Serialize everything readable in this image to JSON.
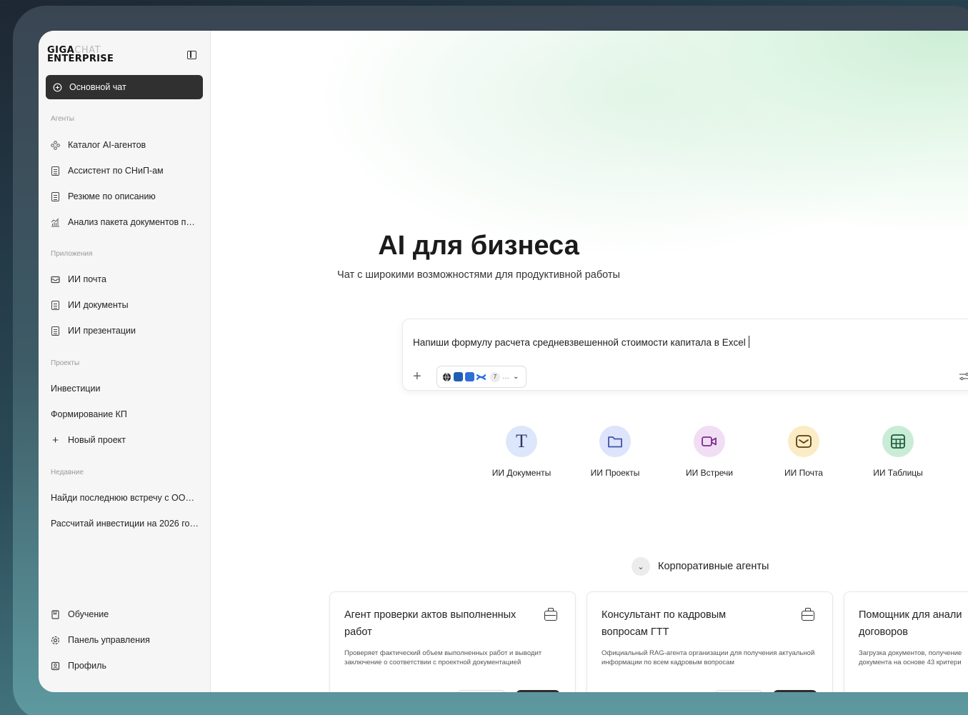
{
  "logo": {
    "part1": "GIGA",
    "part2": "CHAT",
    "part3": "ENTERPRISE"
  },
  "sidebar": {
    "main_chat": "Основной чат",
    "agents_label": "Агенты",
    "agents": [
      {
        "label": "Каталог AI-агентов",
        "icon": "agents-catalog-icon"
      },
      {
        "label": "Ассистент по СНиП-ам",
        "icon": "document-icon"
      },
      {
        "label": "Резюме по описанию",
        "icon": "document-icon"
      },
      {
        "label": "Анализ пакета документов п…",
        "icon": "chart-icon"
      }
    ],
    "apps_label": "Приложения",
    "apps": [
      {
        "label": "ИИ почта",
        "icon": "mail-icon"
      },
      {
        "label": "ИИ документы",
        "icon": "document-icon"
      },
      {
        "label": "ИИ презентации",
        "icon": "document-icon"
      }
    ],
    "projects_label": "Проекты",
    "projects": [
      "Инвестиции",
      "Формирование КП"
    ],
    "new_project": "Новый проект",
    "recent_label": "Недавние",
    "recent": [
      "Найди последнюю встречу с ОО…",
      "Рассчитай инвестиции на 2026 го…"
    ],
    "bottom": [
      {
        "label": "Обучение",
        "icon": "book-icon"
      },
      {
        "label": "Панель управления",
        "icon": "settings-icon"
      },
      {
        "label": "Профиль",
        "icon": "profile-icon"
      }
    ]
  },
  "hero": {
    "title": "AI для бизнеса",
    "subtitle": "Чат с широкими возможностями для продуктивной работы"
  },
  "prompt": {
    "text": "Напиши формулу расчета средневзвешенной стоимости капитала в Excel",
    "tools_count": "7",
    "more": "…"
  },
  "quick_apps": [
    {
      "label": "ИИ Документы",
      "glyph": "T",
      "icon": "text-icon",
      "bg": "#dde7fb"
    },
    {
      "label": "ИИ Проекты",
      "glyph": "",
      "icon": "folder-icon",
      "bg": "#dde4fb"
    },
    {
      "label": "ИИ Встречи",
      "glyph": "",
      "icon": "video-icon",
      "bg": "#f1def5"
    },
    {
      "label": "ИИ Почта",
      "glyph": "",
      "icon": "mail-icon",
      "bg": "#fbecc6"
    },
    {
      "label": "ИИ Таблицы",
      "glyph": "",
      "icon": "table-icon",
      "bg": "#c9ecd7"
    }
  ],
  "corporate": {
    "heading": "Корпоративные агенты",
    "cards": [
      {
        "title": "Агент проверки актов выполненных работ",
        "desc": "Проверяет фактический объем выполненных работ и выводит заключение о соответствии с проектной документацией"
      },
      {
        "title": "Консультант по кадровым вопросам ГТТ",
        "desc": "Официальный RAG-агента организации для получения актуальной информации по всем кадровым вопросам"
      },
      {
        "title": "Помощник для анали договоров",
        "desc": "Загрузка документов, получение документа на основе 43 критери"
      }
    ]
  }
}
